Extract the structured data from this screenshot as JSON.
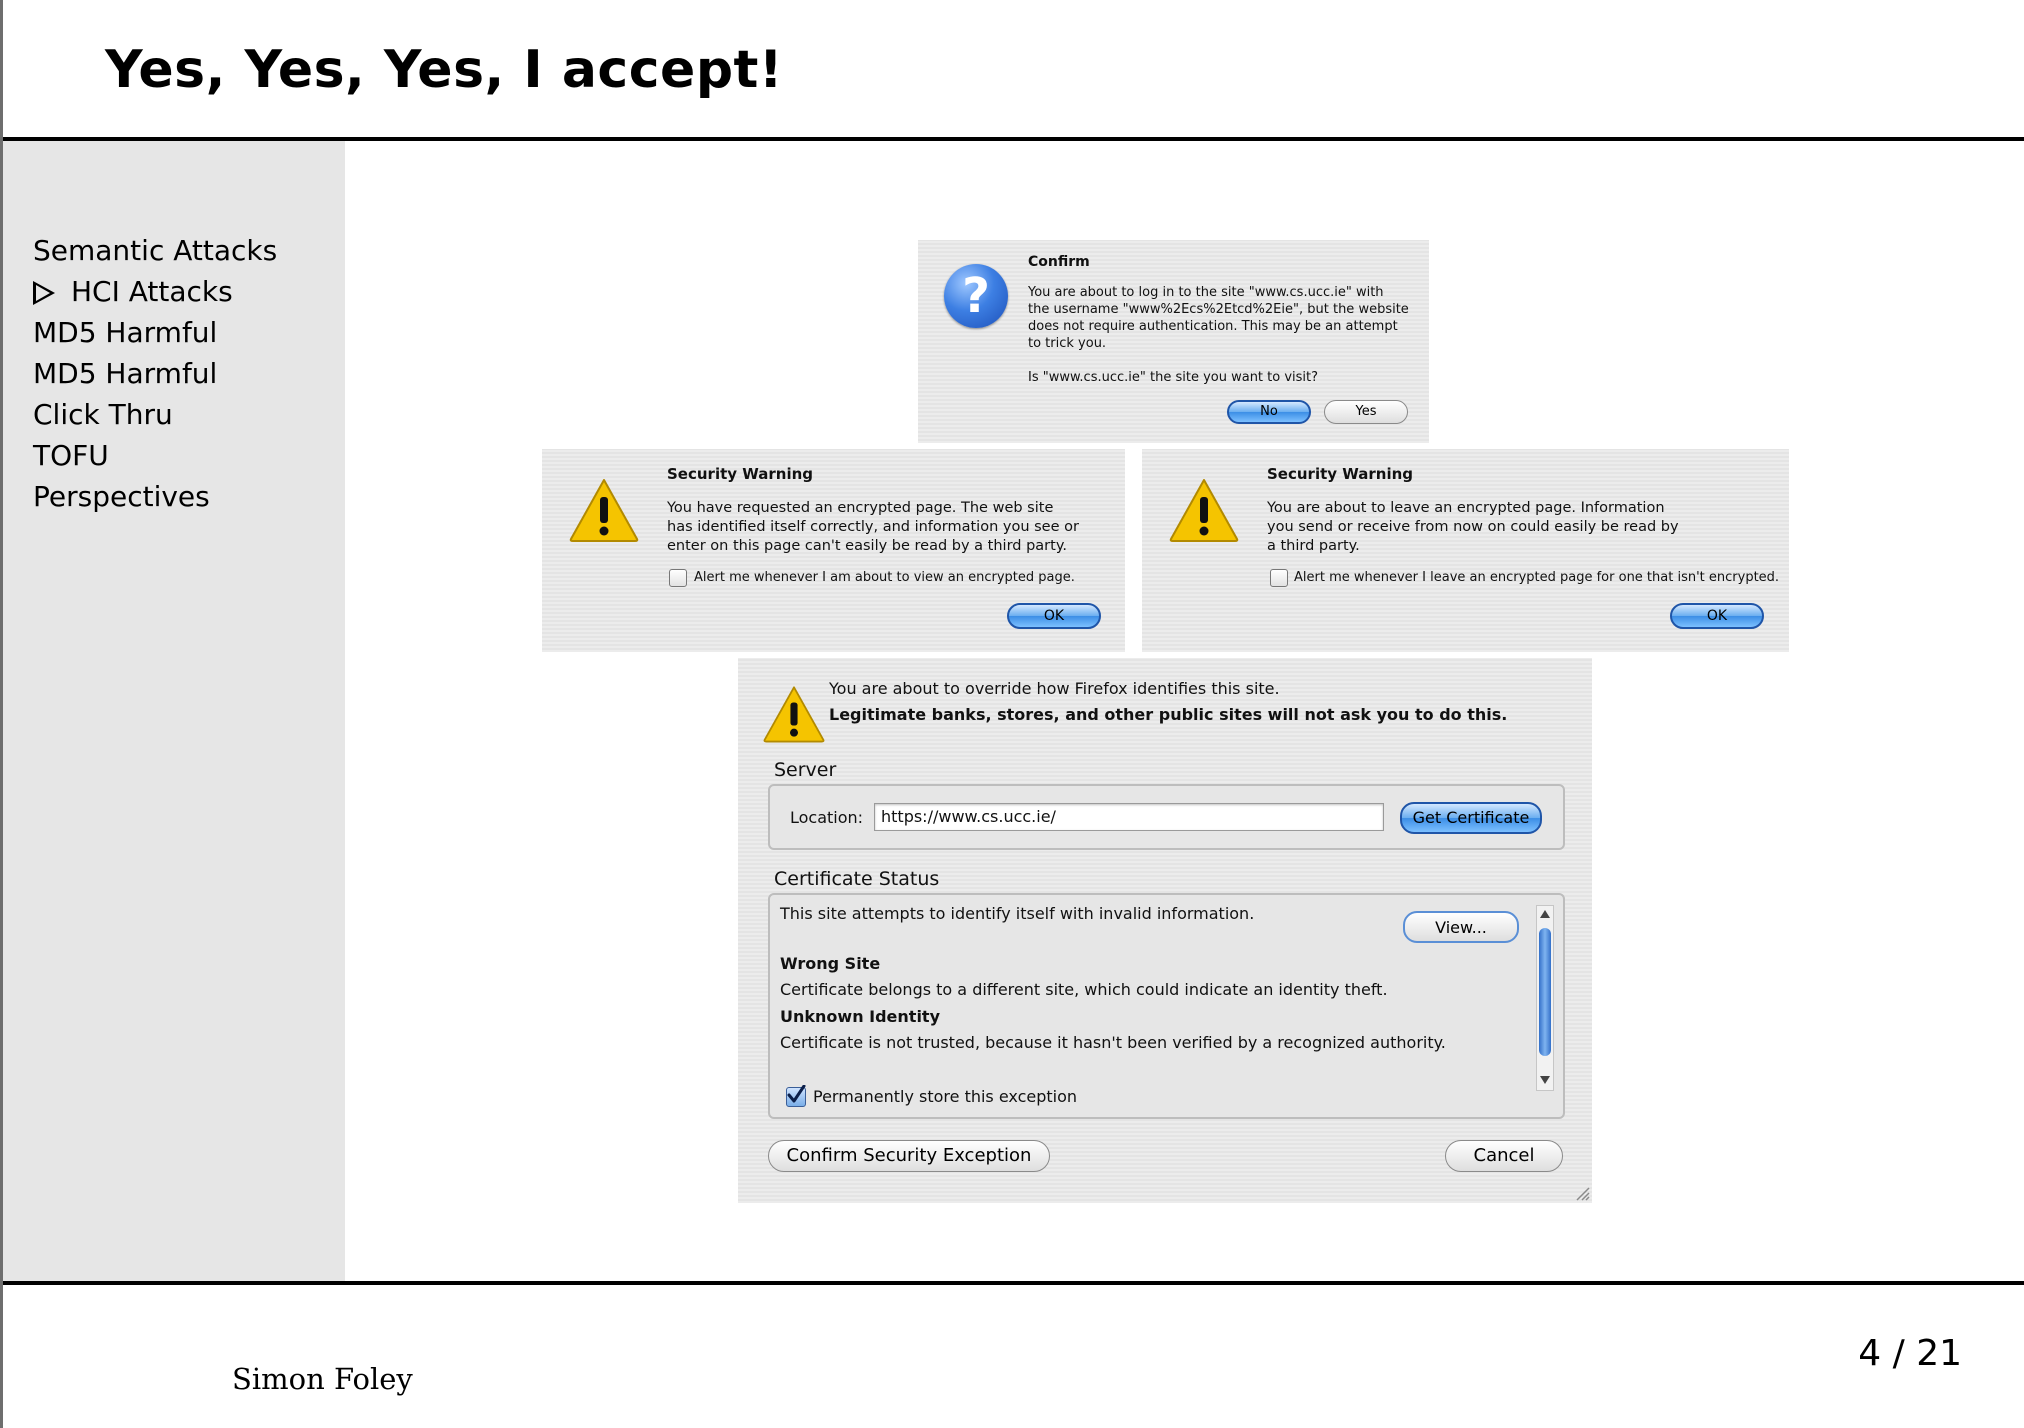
{
  "slide": {
    "title": "Yes, Yes, Yes, I accept!",
    "author": "Simon Foley",
    "page_number": "4",
    "page_total": "21"
  },
  "nav": {
    "items": [
      {
        "label": "Semantic Attacks",
        "current": false
      },
      {
        "label": "HCI Attacks",
        "current": true
      },
      {
        "label": "MD5 Harmful",
        "current": false
      },
      {
        "label": "MD5 Harmful",
        "current": false
      },
      {
        "label": "Click Thru",
        "current": false
      },
      {
        "label": "TOFU",
        "current": false
      },
      {
        "label": "Perspectives",
        "current": false
      }
    ]
  },
  "confirm_dialog": {
    "title": "Confirm",
    "message_lines": [
      "You are about to log in to the site \"www.cs.ucc.ie\" with",
      "the username \"www%2Ecs%2Etcd%2Eie\", but the website",
      "does not require authentication. This may be an attempt",
      "to trick you."
    ],
    "question": "Is \"www.cs.ucc.ie\" the site you want to visit?",
    "no_label": "No",
    "yes_label": "Yes",
    "icon": "question-icon"
  },
  "warning_left": {
    "title": "Security Warning",
    "message_lines": [
      "You have requested an encrypted page. The web site",
      "has identified itself correctly, and information you see or",
      "enter on this page can't easily be read by a third party."
    ],
    "checkbox_label": "Alert me whenever I am about to view an encrypted page.",
    "checked": false,
    "ok_label": "OK",
    "icon": "warning-icon"
  },
  "warning_right": {
    "title": "Security Warning",
    "message_lines": [
      "You are about to leave an encrypted page. Information",
      "you send or receive from now on could easily be read by",
      "a third party."
    ],
    "checkbox_label": "Alert me whenever I leave an encrypted page for one that isn't encrypted.",
    "checked": false,
    "ok_label": "OK",
    "icon": "warning-icon"
  },
  "exception_dialog": {
    "intro": "You are about to override how Firefox identifies this site.",
    "intro_bold": "Legitimate banks, stores, and other public sites will not ask you to do this.",
    "server_heading": "Server",
    "location_label": "Location:",
    "location_value": "https://www.cs.ucc.ie/",
    "get_certificate_label": "Get Certificate",
    "status_heading": "Certificate Status",
    "status_summary": "This site attempts to identify itself with invalid information.",
    "view_label": "View...",
    "wrong_site_heading": "Wrong Site",
    "wrong_site_text": "Certificate belongs to a different site, which could indicate an identity theft.",
    "unknown_identity_heading": "Unknown Identity",
    "unknown_identity_text": "Certificate is not trusted, because it hasn't been verified by a recognized authority.",
    "permanent_label": "Permanently store this exception",
    "permanent_checked": true,
    "confirm_label": "Confirm Security Exception",
    "cancel_label": "Cancel",
    "icon": "warning-icon"
  },
  "colors": {
    "sidebar_bg": "#e6e6e6",
    "accent_blue": "#3c8ee6",
    "warning_yellow": "#f5c400"
  }
}
